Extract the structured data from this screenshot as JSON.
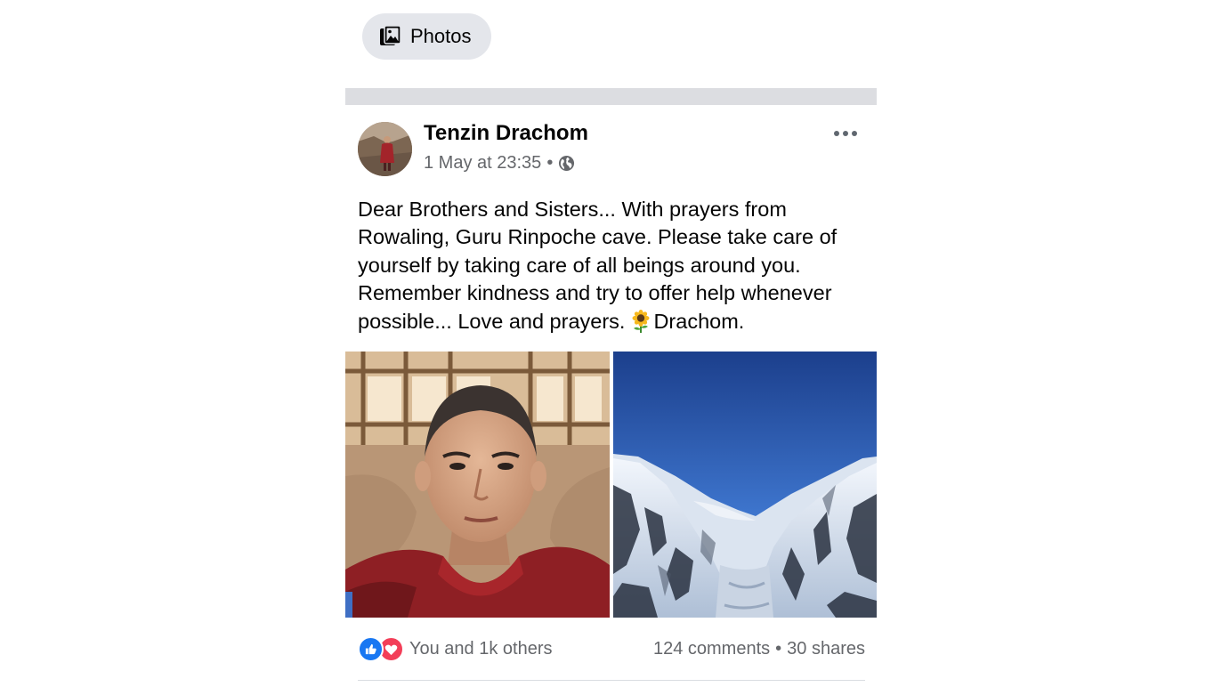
{
  "filter_chip": {
    "label": "Photos",
    "icon": "photos-icon"
  },
  "post": {
    "author": "Tenzin Drachom",
    "timestamp": "1 May at 23:35",
    "separator": "•",
    "audience_icon": "globe-icon",
    "more_icon": "more-options-icon",
    "text_lines": [
      "Dear Brothers and Sisters... With prayers from",
      "Rowaling, Guru Rinpoche cave. Please take care of",
      "yourself by taking care of all beings around you.",
      "Remember kindness and try to offer help whenever"
    ],
    "text_last_before": "possible... Love and prayers.",
    "text_last_after": "Drachom.",
    "emoji": "sunflower-emoji",
    "photos": [
      {
        "name": "monk-portrait-photo"
      },
      {
        "name": "snowy-mountain-valley-photo"
      }
    ],
    "reactions": {
      "icons": [
        "like-icon",
        "love-icon"
      ],
      "summary": "You and 1k others"
    },
    "comments": "124 comments",
    "shares": "30 shares",
    "colors": {
      "like": "#1877f2",
      "love": "#f33e58",
      "secondary_text": "#65676b",
      "chip_bg": "#e4e6eb"
    }
  }
}
